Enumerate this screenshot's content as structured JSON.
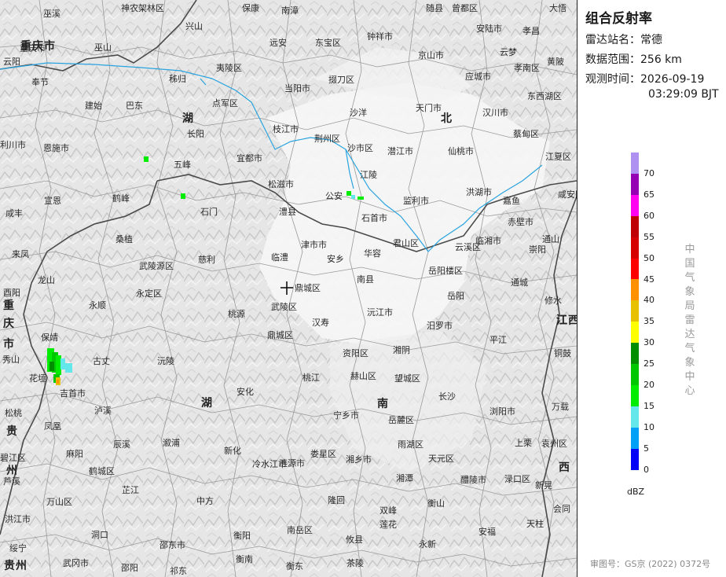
{
  "panel": {
    "title": "组合反射率",
    "station_label": "雷达站名：",
    "station_value": "常德",
    "range_label": "数据范围：",
    "range_value": "256 km",
    "time_label": "观测时间：",
    "time_date": "2026-09-19",
    "time_clock": "03:29:09 BJT",
    "unit": "dBZ",
    "credit": "中国气象局雷达气象中心",
    "approval": "审图号：GS京 (2022) 0372号"
  },
  "legend": [
    {
      "label": "70",
      "color": "#ad90f0"
    },
    {
      "label": "65",
      "color": "#9600b4"
    },
    {
      "label": "60",
      "color": "#ff00f0"
    },
    {
      "label": "55",
      "color": "#c00000"
    },
    {
      "label": "50",
      "color": "#d60000"
    },
    {
      "label": "45",
      "color": "#ff0000"
    },
    {
      "label": "40",
      "color": "#ff9000"
    },
    {
      "label": "35",
      "color": "#e7c000"
    },
    {
      "label": "30",
      "color": "#ffff00"
    },
    {
      "label": "25",
      "color": "#008e00"
    },
    {
      "label": "20",
      "color": "#00c800"
    },
    {
      "label": "15",
      "color": "#00ec00"
    },
    {
      "label": "10",
      "color": "#64e7eb"
    },
    {
      "label": "5",
      "color": "#01a0f6"
    },
    {
      "label": "0",
      "color": "#0000f6"
    }
  ],
  "map_labels": {
    "places": [
      "巫溪",
      "神农架林区",
      "保康",
      "南漳",
      "随县",
      "曾都区",
      "大悟",
      "兴山",
      "远安",
      "东宝区",
      "钟祥市",
      "安陆市",
      "孝昌",
      "重庆市",
      "巫山",
      "云阳",
      "夷陵区",
      "京山市",
      "云梦",
      "孝南区",
      "黄陂",
      "奉节",
      "秭归",
      "当阳市",
      "掇刀区",
      "应城市",
      "东西湖区",
      "建始",
      "巴东",
      "点军区",
      "天门市",
      "沙洋",
      "汉川市",
      "恩施市",
      "长阳",
      "枝江市",
      "荆州区",
      "潜江市",
      "仙桃市",
      "蔡甸区",
      "利川市",
      "宜都市",
      "沙市区",
      "江夏区",
      "五峰",
      "江陵",
      "松滋市",
      "洪湖市",
      "公安",
      "监利市",
      "嘉鱼",
      "咸安区",
      "宣恩",
      "鹤峰",
      "石门",
      "澧县",
      "石首市",
      "赤壁市",
      "咸丰",
      "桑植",
      "津市市",
      "临湘市",
      "通山",
      "来凤",
      "武陵源区",
      "慈利",
      "临澧",
      "安乡",
      "华容",
      "君山区",
      "云溪区",
      "崇阳",
      "龙山",
      "鼎城区",
      "南县",
      "岳阳楼区",
      "通城",
      "永顺",
      "永定区",
      "武陵区",
      "岳阳",
      "修水",
      "酉阳",
      "桃源",
      "汉寿",
      "沅江市",
      "汨罗市",
      "平江",
      "保靖",
      "鼎城区",
      "湘阴",
      "铜鼓",
      "秀山",
      "古丈",
      "沅陵",
      "资阳区",
      "赫山区",
      "花垣",
      "吉首市",
      "桃江",
      "望城区",
      "长沙",
      "万载",
      "安化",
      "泸溪",
      "宁乡市",
      "岳麓区",
      "浏阳市",
      "松桃",
      "凤凰",
      "辰溪",
      "溆浦",
      "新化",
      "冷水江市",
      "涟源市",
      "娄星区",
      "湘乡市",
      "雨湖区",
      "天元区",
      "上栗",
      "袁州区",
      "碧江区",
      "麻阳",
      "鹤城区",
      "湘潭",
      "醴陵市",
      "芦溪",
      "万山区",
      "芷江",
      "中方",
      "隆回",
      "双峰",
      "衡山",
      "渌口区",
      "新晃",
      "洪江市",
      "洞口",
      "邵东市",
      "衡阳",
      "南岳区",
      "攸县",
      "莲花",
      "安福",
      "天柱",
      "会同",
      "绥宁",
      "武冈市",
      "邵阳",
      "祁东",
      "衡南",
      "衡东",
      "茶陵",
      "永新"
    ],
    "provinces": [
      "湖",
      "北",
      "湖",
      "南",
      "重",
      "庆",
      "市",
      "贵",
      "州",
      "贵州",
      "江",
      "西",
      "重庆市",
      "江西"
    ]
  }
}
